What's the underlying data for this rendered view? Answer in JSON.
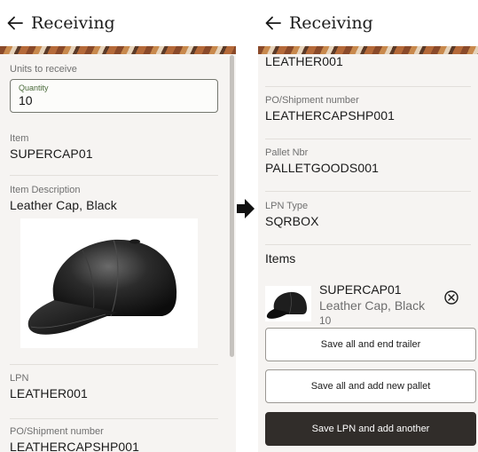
{
  "left": {
    "header": {
      "title": "Receiving"
    },
    "units_label": "Units to receive",
    "quantity": {
      "label": "Quantity",
      "value": "10"
    },
    "item": {
      "label": "Item",
      "value": "SUPERCAP01"
    },
    "description": {
      "label": "Item Description",
      "value": "Leather Cap, Black"
    },
    "lpn": {
      "label": "LPN",
      "value": "LEATHER001"
    },
    "po": {
      "label": "PO/Shipment number",
      "value": "LEATHERCAPSHP001"
    }
  },
  "right": {
    "header": {
      "title": "Receiving"
    },
    "lpn_value": "LEATHER001",
    "po": {
      "label": "PO/Shipment number",
      "value": "LEATHERCAPSHP001"
    },
    "pallet": {
      "label": "Pallet Nbr",
      "value": "PALLETGOODS001"
    },
    "lpn_type": {
      "label": "LPN Type",
      "value": "SQRBOX"
    },
    "items_heading": "Items",
    "items": [
      {
        "code": "SUPERCAP01",
        "description": "Leather Cap, Black",
        "qty": "10"
      }
    ],
    "buttons": {
      "end_trailer": "Save all and end trailer",
      "new_pallet": "Save all and add new pallet",
      "save_lpn": "Save LPN and add another"
    }
  },
  "icons": {
    "back": "back-arrow-icon",
    "remove": "remove-circle-icon",
    "next": "right-arrow-icon"
  }
}
